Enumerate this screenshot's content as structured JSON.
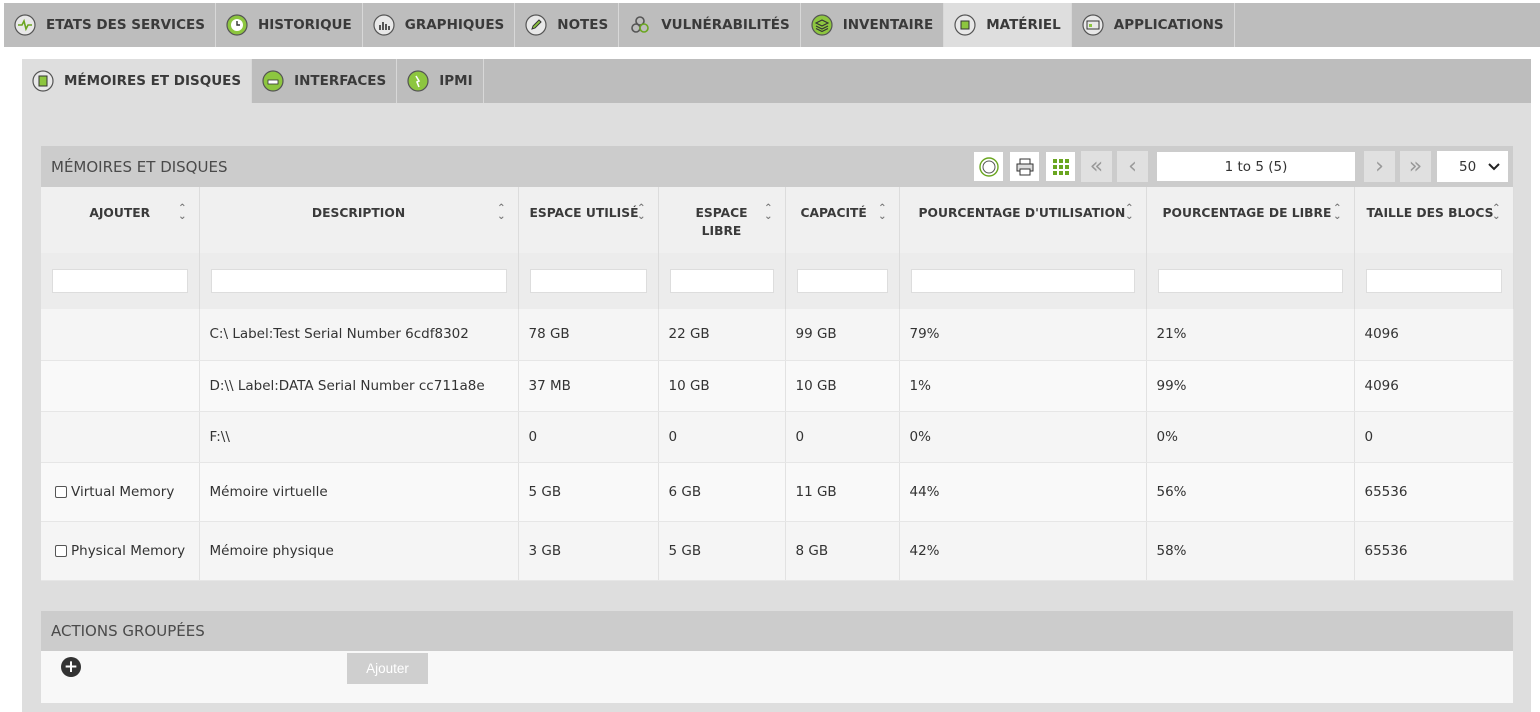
{
  "top_tabs": [
    {
      "label": "ETATS DES SERVICES",
      "icon": "heartbeat-icon"
    },
    {
      "label": "HISTORIQUE",
      "icon": "clock-icon"
    },
    {
      "label": "GRAPHIQUES",
      "icon": "bar-chart-icon"
    },
    {
      "label": "NOTES",
      "icon": "pencil-icon"
    },
    {
      "label": "VULNÉRABILITÉS",
      "icon": "biohazard-icon"
    },
    {
      "label": "INVENTAIRE",
      "icon": "layers-icon"
    },
    {
      "label": "MATÉRIEL",
      "icon": "chip-icon",
      "active": true
    },
    {
      "label": "APPLICATIONS",
      "icon": "applications-icon"
    }
  ],
  "sub_tabs": [
    {
      "label": "MÉMOIRES ET DISQUES",
      "icon": "disk-icon",
      "active": true
    },
    {
      "label": "INTERFACES",
      "icon": "network-icon"
    },
    {
      "label": "IPMI",
      "icon": "ipmi-icon"
    }
  ],
  "panel": {
    "title": "MÉMOIRES ET DISQUES",
    "pager": "1 to 5 (5)",
    "page_size": "50"
  },
  "table": {
    "headers": [
      "AJOUTER",
      "DESCRIPTION",
      "ESPACE UTILISÉ",
      "ESPACE LIBRE",
      "CAPACITÉ",
      "POURCENTAGE D'UTILISATION",
      "POURCENTAGE DE LIBRE",
      "TAILLE DES BLOCS"
    ],
    "rows": [
      {
        "ajouter": "",
        "has_checkbox": false,
        "description": "C:\\ Label:Test Serial Number 6cdf8302",
        "used": "78 GB",
        "free": "22 GB",
        "capacity": "99 GB",
        "pct_used": "79%",
        "pct_free": "21%",
        "block": "4096"
      },
      {
        "ajouter": "",
        "has_checkbox": false,
        "description": "D:\\\\ Label:DATA Serial Number cc711a8e",
        "used": "37 MB",
        "free": "10 GB",
        "capacity": "10 GB",
        "pct_used": "1%",
        "pct_free": "99%",
        "block": "4096"
      },
      {
        "ajouter": "",
        "has_checkbox": false,
        "description": "F:\\\\",
        "used": "0",
        "free": "0",
        "capacity": "0",
        "pct_used": "0%",
        "pct_free": "0%",
        "block": "0"
      },
      {
        "ajouter": "Virtual Memory",
        "has_checkbox": true,
        "description": "Mémoire virtuelle",
        "used": "5 GB",
        "free": "6 GB",
        "capacity": "11 GB",
        "pct_used": "44%",
        "pct_free": "56%",
        "block": "65536"
      },
      {
        "ajouter": "Physical Memory",
        "has_checkbox": true,
        "description": "Mémoire physique",
        "used": "3 GB",
        "free": "5 GB",
        "capacity": "8 GB",
        "pct_used": "42%",
        "pct_free": "58%",
        "block": "65536"
      }
    ]
  },
  "actions": {
    "title": "ACTIONS GROUPÉES",
    "add_label": "Ajouter"
  },
  "colors": {
    "icon_green": "#8dc63f",
    "tab_bar": "#bdbdbd",
    "active_tab": "#dedede"
  }
}
